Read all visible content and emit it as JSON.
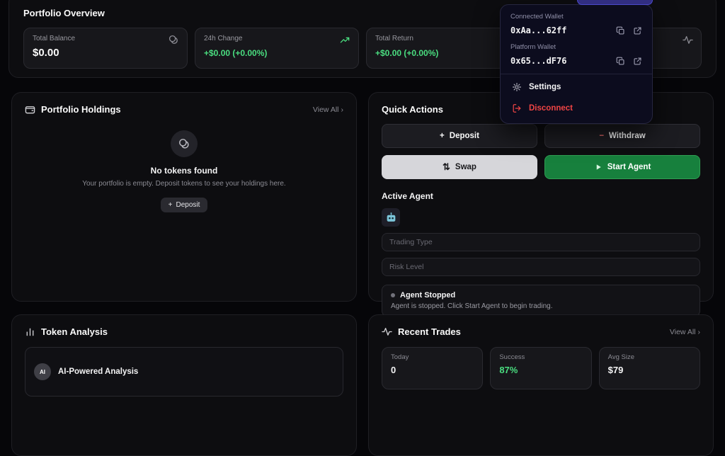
{
  "colors": {
    "green": "#4ade80",
    "red": "#ef4444",
    "card_bg": "#0d0d10",
    "accent_indigo": "#4b48c9"
  },
  "icons": {
    "chevron_right": "›",
    "plus": "+",
    "minus": "−",
    "swap": "⇅"
  },
  "overview": {
    "title": "Portfolio Overview",
    "stats": [
      {
        "label": "Total Balance",
        "value": "$0.00",
        "icon": "coins-icon"
      },
      {
        "label": "24h Change",
        "value": "+$0.00 (+0.00%)",
        "icon": "trending-up-icon"
      },
      {
        "label": "Total Return",
        "value": "+$0.00 (+0.00%)"
      },
      {
        "icon": "activity-icon"
      }
    ]
  },
  "wallet_menu": {
    "connected_wallet_label": "Connected Wallet",
    "connected_wallet_address": "0xAa...62ff",
    "platform_wallet_label": "Platform Wallet",
    "platform_wallet_address": "0x65...dF76",
    "settings_label": "Settings",
    "disconnect_label": "Disconnect"
  },
  "holdings": {
    "title": "Portfolio Holdings",
    "view_all": "View All",
    "empty_title": "No tokens found",
    "empty_subtitle": "Your portfolio is empty. Deposit tokens to see your holdings here.",
    "deposit_button": "Deposit"
  },
  "quick_actions": {
    "title": "Quick Actions",
    "deposit": "Deposit",
    "withdraw": "Withdraw",
    "swap": "Swap",
    "start_agent": "Start Agent",
    "active_agent_title": "Active Agent",
    "trading_type_placeholder": "Trading Type",
    "risk_level_placeholder": "Risk Level",
    "agent_status_title": "Agent Stopped",
    "agent_status_text": "Agent is stopped. Click Start Agent to begin trading."
  },
  "token_analysis": {
    "title": "Token Analysis",
    "ai_badge": "AI",
    "ai_title": "AI-Powered Analysis"
  },
  "recent_trades": {
    "title": "Recent Trades",
    "view_all": "View All",
    "stats": [
      {
        "label": "Today",
        "value": "0",
        "color": "white"
      },
      {
        "label": "Success",
        "value": "87%",
        "color": "green"
      },
      {
        "label": "Avg Size",
        "value": "$79",
        "color": "white"
      }
    ]
  }
}
